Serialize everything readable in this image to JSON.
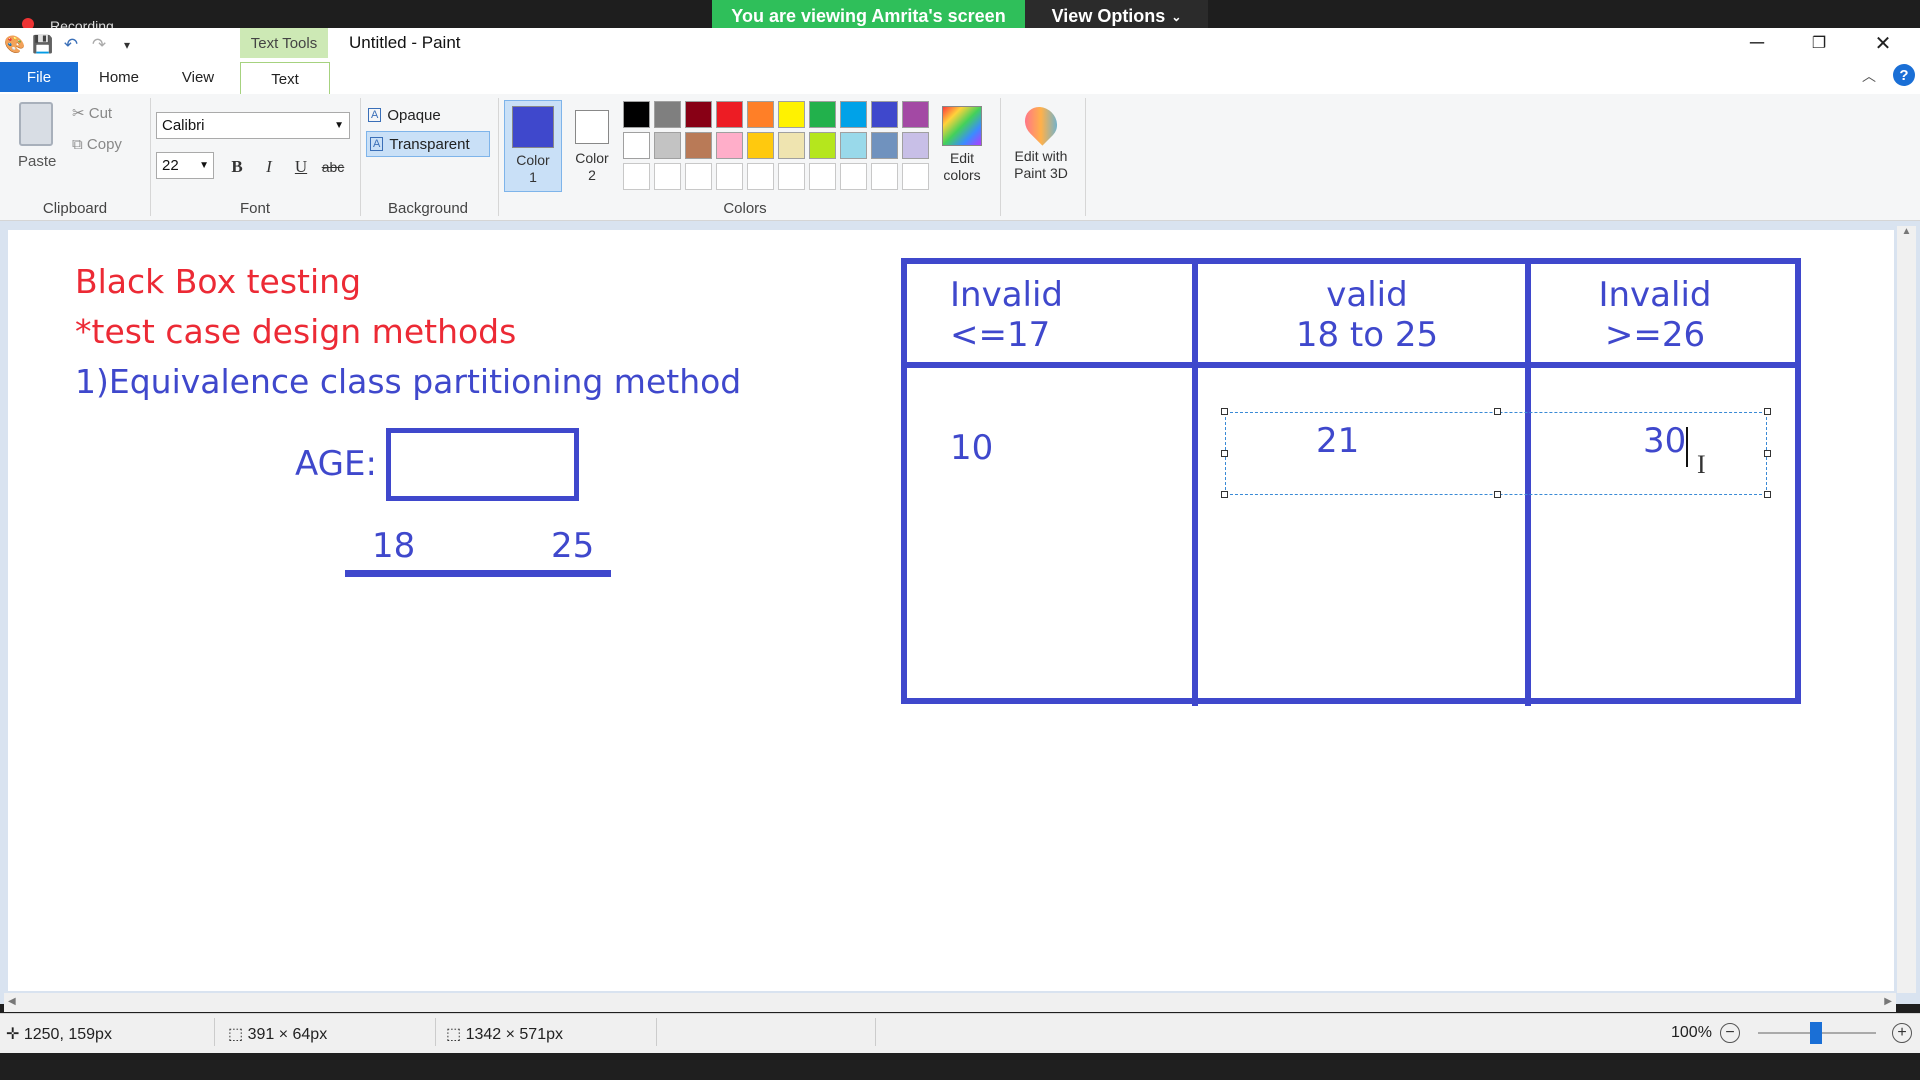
{
  "zoom_bar": {
    "banner_text": "You are viewing Amrita's screen",
    "view_options_label": "View Options",
    "recording_text": "Recording..."
  },
  "window": {
    "title": "Untitled - Paint",
    "context_tab": "Text Tools"
  },
  "tabs": [
    "File",
    "Home",
    "View",
    "Text"
  ],
  "ribbon": {
    "clipboard": {
      "paste": "Paste",
      "cut": "Cut",
      "copy": "Copy",
      "label": "Clipboard"
    },
    "font": {
      "family": "Calibri",
      "size": "22",
      "label": "Font"
    },
    "background": {
      "opaque": "Opaque",
      "transparent": "Transparent",
      "label": "Background"
    },
    "colors": {
      "color1_label": "Color\n1",
      "color2_label": "Color\n2",
      "color1": "#3f48cc",
      "color2": "#ffffff",
      "edit_colors": "Edit colors",
      "edit_3d": "Edit with Paint 3D",
      "label": "Colors",
      "palette_row1": [
        "#000000",
        "#7f7f7f",
        "#880015",
        "#ed1c24",
        "#ff7f27",
        "#fff200",
        "#22b14c",
        "#00a2e8",
        "#3f48cc",
        "#a349a4"
      ],
      "palette_row2": [
        "#ffffff",
        "#c3c3c3",
        "#b97a57",
        "#ffaec9",
        "#ffc90e",
        "#efe4b0",
        "#b5e61d",
        "#99d9ea",
        "#7092be",
        "#c8bfe7"
      ]
    }
  },
  "drawing": {
    "heading1": "Black Box testing",
    "heading2": "*test case design methods",
    "heading3": "1)Equivalence class partitioning method",
    "age_label": "AGE:",
    "range_low": "18",
    "range_high": "25",
    "table": {
      "col1_line1": "Invalid",
      "col1_line2": "<=17",
      "col2_line1": "valid",
      "col2_line2": "18 to 25",
      "col3_line1": "Invalid",
      "col3_line2": ">=26",
      "val1": "10",
      "val2": "21",
      "val3": "30"
    }
  },
  "status": {
    "cursor_pos": "1250, 159px",
    "selection_size": "391 × 64px",
    "image_size": "1342 × 571px",
    "zoom": "100%"
  }
}
